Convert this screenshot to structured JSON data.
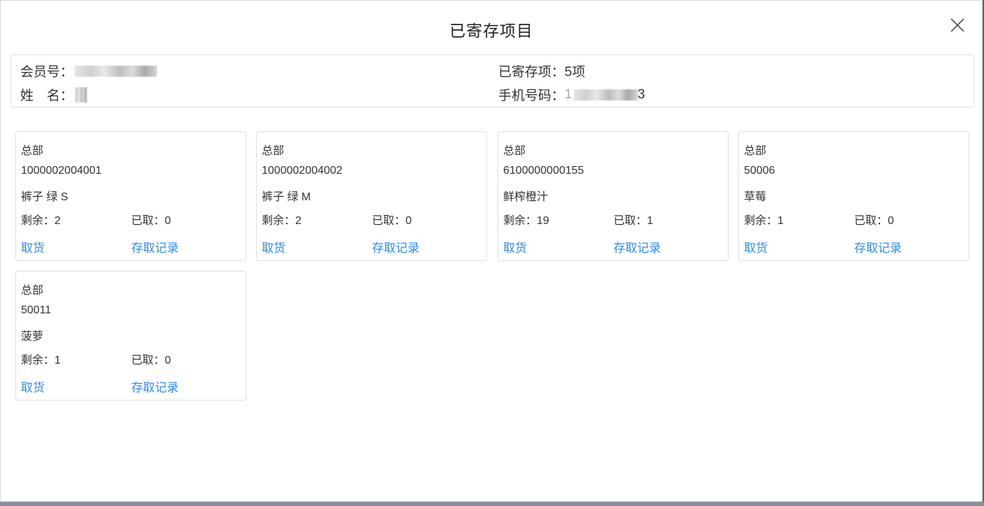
{
  "dialog": {
    "title": "已寄存项目"
  },
  "member": {
    "member_no_label": "会员号：",
    "name_label": "姓　名：",
    "deposit_count_label": "已寄存项：",
    "deposit_count_value": "5项",
    "phone_label": "手机号码：",
    "phone_visible_prefix": "1",
    "phone_visible_suffix": "3"
  },
  "items": [
    {
      "store": "总部",
      "code": "1000002004001",
      "name": "裤子 绿 S",
      "remaining_label": "剩余：",
      "remaining": "2",
      "taken_label": "已取：",
      "taken": "0",
      "pickup_label": "取货",
      "history_label": "存取记录"
    },
    {
      "store": "总部",
      "code": "1000002004002",
      "name": "裤子 绿 M",
      "remaining_label": "剩余：",
      "remaining": "2",
      "taken_label": "已取：",
      "taken": "0",
      "pickup_label": "取货",
      "history_label": "存取记录"
    },
    {
      "store": "总部",
      "code": "6100000000155",
      "name": "鲜榨橙汁",
      "remaining_label": "剩余：",
      "remaining": "19",
      "taken_label": "已取：",
      "taken": "1",
      "pickup_label": "取货",
      "history_label": "存取记录"
    },
    {
      "store": "总部",
      "code": "50006",
      "name": "草莓",
      "remaining_label": "剩余：",
      "remaining": "1",
      "taken_label": "已取：",
      "taken": "0",
      "pickup_label": "取货",
      "history_label": "存取记录"
    },
    {
      "store": "总部",
      "code": "50011",
      "name": "菠萝",
      "remaining_label": "剩余：",
      "remaining": "1",
      "taken_label": "已取：",
      "taken": "0",
      "pickup_label": "取货",
      "history_label": "存取记录"
    }
  ],
  "colors": {
    "link": "#2d8cf0",
    "border": "#dcdfe6"
  },
  "icons": {
    "close": "close-icon"
  }
}
